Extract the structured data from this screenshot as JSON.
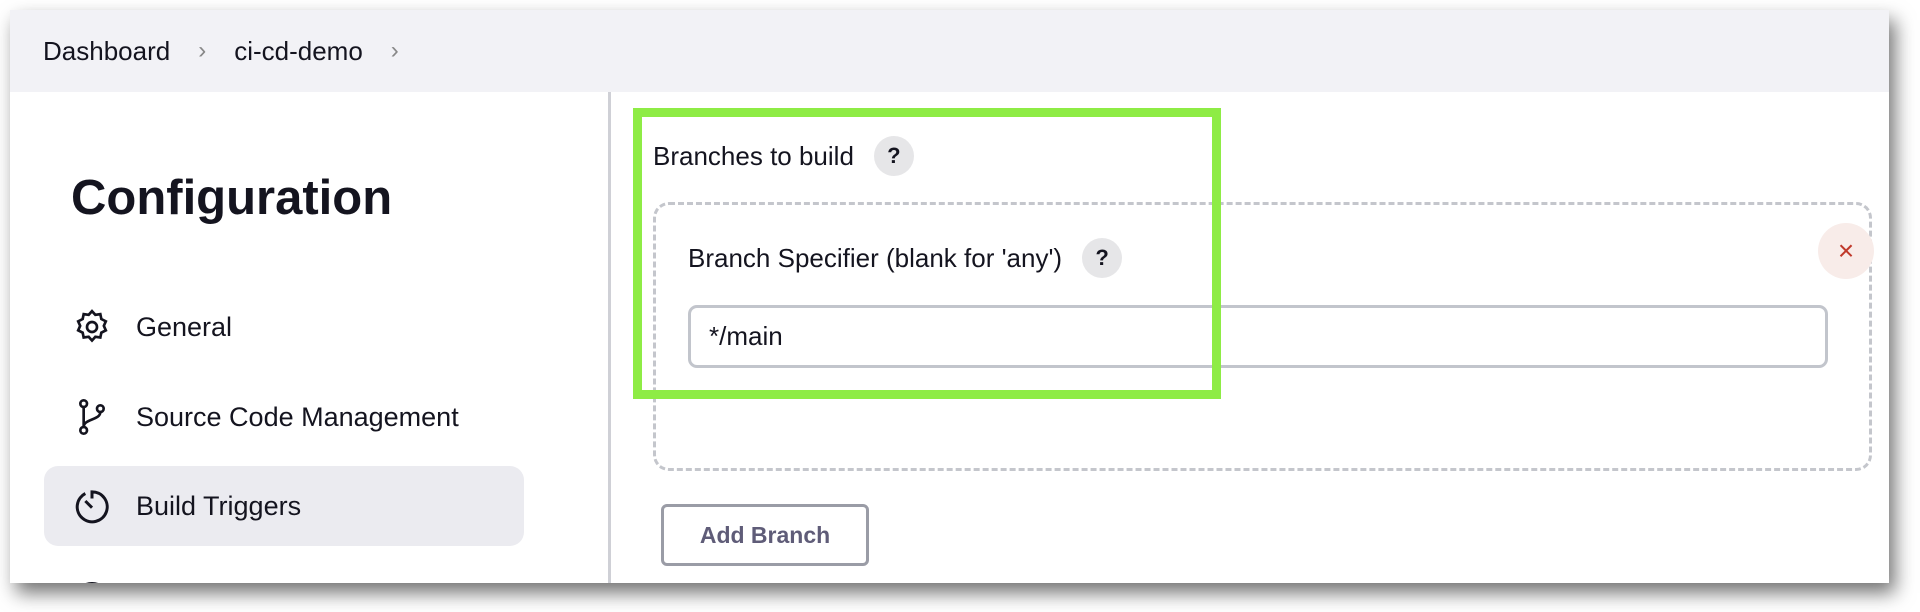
{
  "breadcrumb": {
    "items": [
      "Dashboard",
      "ci-cd-demo"
    ]
  },
  "sidebar": {
    "title": "Configuration",
    "items": [
      {
        "label": "General",
        "icon": "gear-icon"
      },
      {
        "label": "Source Code Management",
        "icon": "git-branch-icon"
      },
      {
        "label": "Build Triggers",
        "icon": "timer-icon",
        "active": true
      }
    ]
  },
  "main": {
    "branches_label": "Branches to build",
    "help": "?",
    "specifier_label": "Branch Specifier (blank for 'any')",
    "specifier_value": "*/main",
    "close": "×",
    "add_branch": "Add Branch"
  },
  "colors": {
    "highlight": "#8eec45",
    "close": "#c0392b"
  }
}
